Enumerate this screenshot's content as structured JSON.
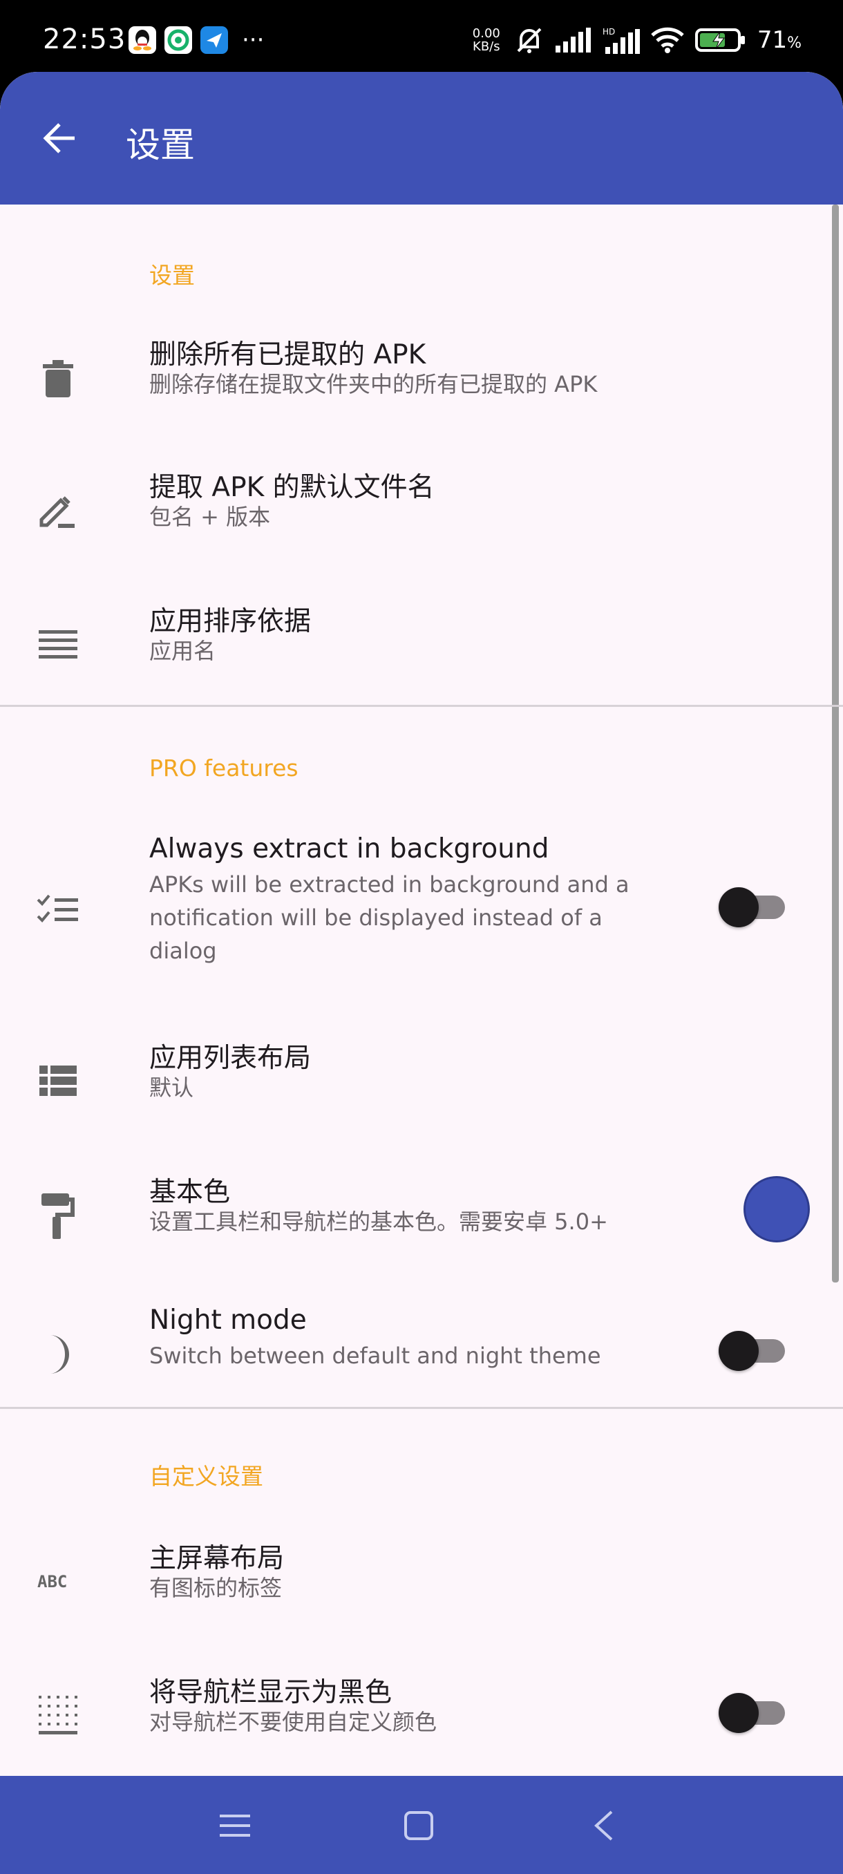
{
  "status_bar": {
    "time": "22:53",
    "net_speed_value": "0.00",
    "net_speed_unit": "KB/s",
    "battery_percent": "71",
    "battery_unit": "%"
  },
  "toolbar": {
    "title": "设置"
  },
  "sections": {
    "settings_header": "设置",
    "pro_header": "PRO features",
    "custom_header": "自定义设置"
  },
  "prefs": {
    "delete_all": {
      "title": "删除所有已提取的 APK",
      "summary": "删除存储在提取文件夹中的所有已提取的 APK",
      "icon": "trash-icon"
    },
    "default_filename": {
      "title": "提取 APK 的默认文件名",
      "summary": "包名 + 版本",
      "icon": "pencil-icon"
    },
    "sort_by": {
      "title": "应用排序依据",
      "summary": "应用名",
      "icon": "sort-lines-icon"
    },
    "extract_background": {
      "title": "Always extract in background",
      "summary": "APKs will be extracted in background and a notification will be displayed instead of a dialog",
      "icon": "checklist-icon",
      "enabled": false
    },
    "list_layout": {
      "title": "应用列表布局",
      "summary": "默认",
      "icon": "list-layout-icon"
    },
    "primary_color": {
      "title": "基本色",
      "summary": "设置工具栏和导航栏的基本色。需要安卓 5.0+",
      "icon": "paint-roller-icon",
      "color": "#3f51b5"
    },
    "night_mode": {
      "title": "Night mode",
      "summary": "Switch between default and night theme",
      "icon": "moon-icon",
      "enabled": false
    },
    "home_layout": {
      "title": "主屏幕布局",
      "summary": "有图标的标签",
      "icon": "abc-icon"
    },
    "black_navbar": {
      "title": "将导航栏显示为黑色",
      "summary": "对导航栏不要使用自定义颜色",
      "icon": "dotted-grid-icon",
      "enabled": false
    }
  },
  "colors": {
    "primary": "#3f51b5",
    "accent_header": "#f2a622",
    "background": "#fdf6fb"
  }
}
